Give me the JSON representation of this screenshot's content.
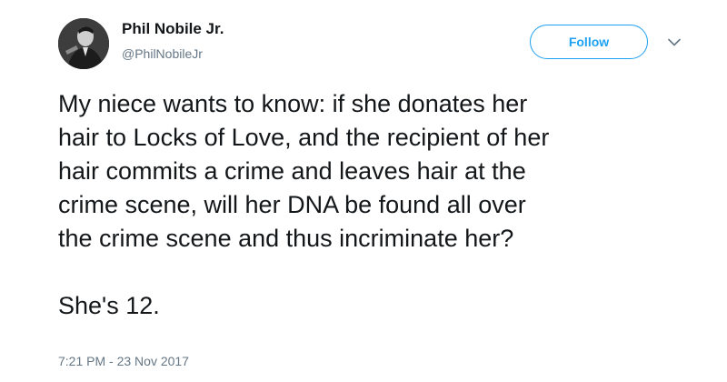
{
  "author": {
    "display_name": "Phil Nobile Jr.",
    "screen_name": "@PhilNobileJr",
    "avatar_icon": "profile-photo"
  },
  "actions": {
    "follow_label": "Follow",
    "more_icon": "chevron-down-icon"
  },
  "tweet": {
    "lines": [
      "My niece wants to know: if she donates her",
      "hair to Locks of Love, and the recipient of her",
      "hair commits a crime and leaves hair at the",
      "crime scene, will her DNA be found all over",
      "the crime scene and thus incriminate her?"
    ],
    "second_paragraph": "She's 12.",
    "timestamp": "7:21 PM - 23 Nov 2017"
  },
  "colors": {
    "text_primary": "#14171a",
    "text_secondary": "#657786",
    "accent": "#1da1f2",
    "background": "#ffffff"
  }
}
